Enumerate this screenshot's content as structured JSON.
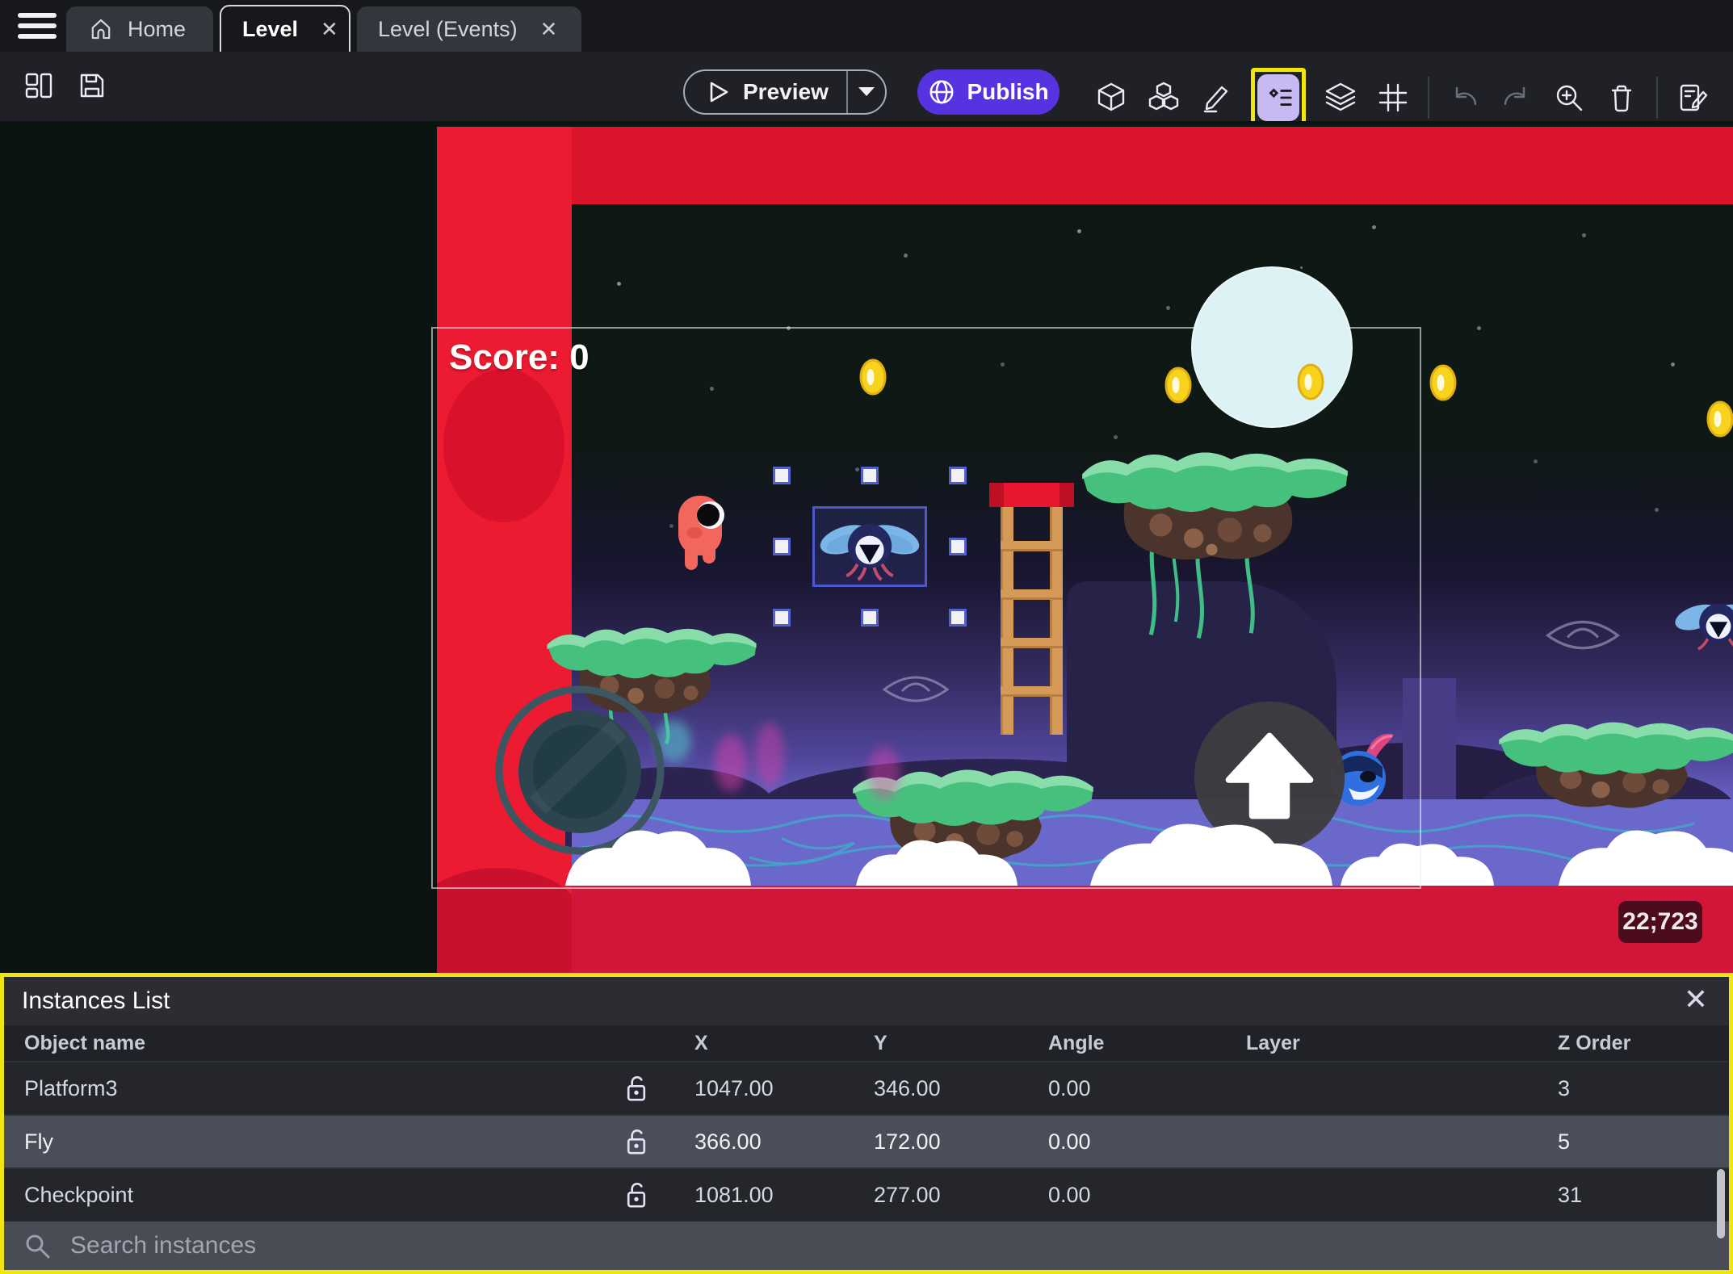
{
  "tab_bar": {
    "close_glyph": "✕",
    "tabs": [
      {
        "label": "Home"
      },
      {
        "label": "Level"
      },
      {
        "label": "Level (Events)"
      }
    ]
  },
  "toolbar": {
    "preview_label": "Preview",
    "publish_label": "Publish"
  },
  "canvas": {
    "score_text": "Score: 0",
    "coordinate_badge": "22;723"
  },
  "instances_panel": {
    "title": "Instances List",
    "close_glyph": "✕",
    "columns": [
      "Object name",
      "X",
      "Y",
      "Angle",
      "Layer",
      "Z Order"
    ],
    "rows": [
      {
        "name": "Platform3",
        "x": "1047.00",
        "y": "346.00",
        "angle": "0.00",
        "layer": "",
        "z_order": "3",
        "selected": false
      },
      {
        "name": "Fly",
        "x": "366.00",
        "y": "172.00",
        "angle": "0.00",
        "layer": "",
        "z_order": "5",
        "selected": true
      },
      {
        "name": "Checkpoint",
        "x": "1081.00",
        "y": "277.00",
        "angle": "0.00",
        "layer": "",
        "z_order": "31",
        "selected": false
      }
    ],
    "search_placeholder": "Search instances"
  },
  "colors": {
    "accent_purple": "#5632e0",
    "highlight_yellow": "#f2e70c",
    "selection_blue": "#5560cf",
    "red_stripe": "#ec1b31",
    "panel_background": "#2b2d33"
  }
}
